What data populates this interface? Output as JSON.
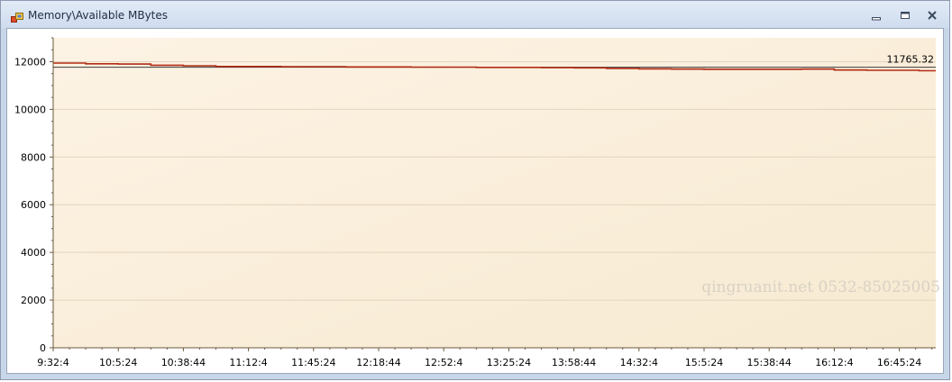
{
  "window": {
    "title": "Memory\\Available MBytes",
    "icons": {
      "app": "counter-chart-icon",
      "minimize": "minimize-icon",
      "maximize": "maximize-icon",
      "close": "close-icon"
    }
  },
  "watermark": "qingruanit.net 0532-85025005",
  "chart_data": {
    "type": "line",
    "title": "",
    "xlabel": "",
    "ylabel": "",
    "ylim": [
      0,
      13000
    ],
    "yticks": [
      0,
      2000,
      4000,
      6000,
      8000,
      10000,
      12000
    ],
    "xticks": [
      "9:32:4",
      "10:5:24",
      "10:38:44",
      "11:12:4",
      "11:45:24",
      "12:18:44",
      "12:52:4",
      "13:25:24",
      "13:58:44",
      "14:32:4",
      "15:5:24",
      "15:38:44",
      "16:12:4",
      "16:45:24"
    ],
    "grid": true,
    "reference_label": "11765.32",
    "reference_value": 11765.32,
    "series": [
      {
        "color": "#b22a12",
        "x": [
          0,
          0.5,
          1,
          1.5,
          2,
          2.5,
          3,
          3.5,
          4,
          4.5,
          5,
          5.5,
          6,
          6.5,
          7,
          7.5,
          8,
          8.5,
          9,
          9.5,
          10,
          10.5,
          11,
          11.5,
          12,
          12.5,
          13,
          13.3
        ],
        "values": [
          11940,
          11910,
          11900,
          11850,
          11830,
          11800,
          11800,
          11790,
          11790,
          11780,
          11780,
          11770,
          11770,
          11760,
          11760,
          11750,
          11740,
          11720,
          11700,
          11690,
          11680,
          11680,
          11680,
          11690,
          11650,
          11640,
          11640,
          11620
        ]
      }
    ]
  }
}
